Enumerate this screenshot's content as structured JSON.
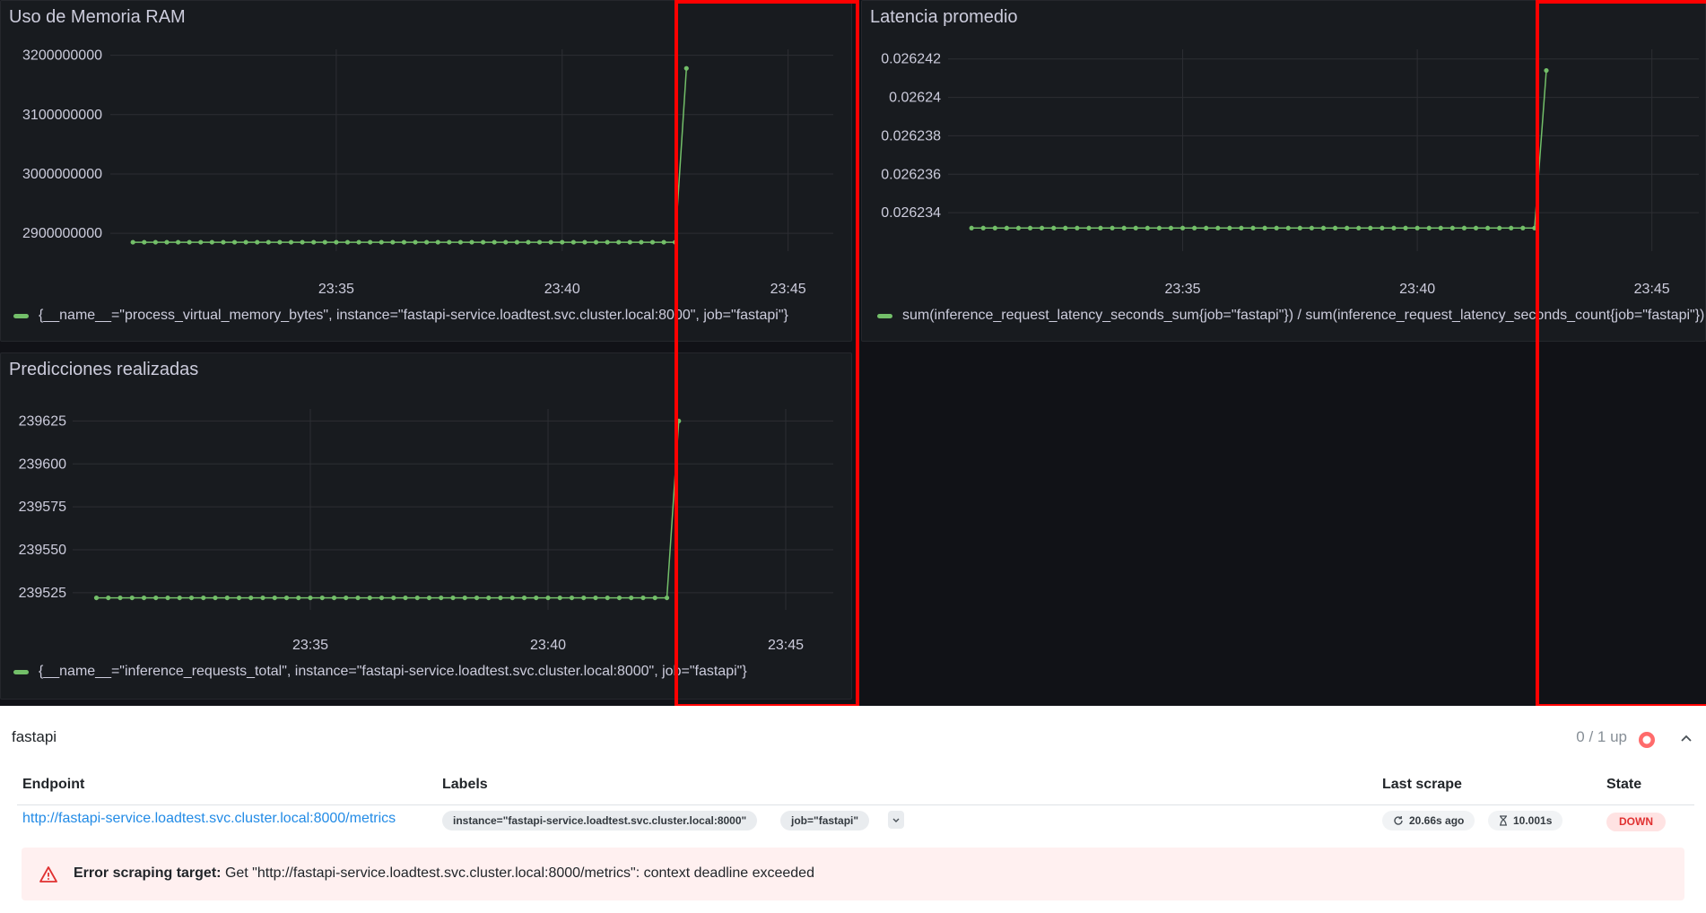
{
  "chart_data": [
    {
      "type": "line",
      "title": "Uso de Memoria RAM",
      "x": [
        "23:30:30",
        "23:30:45",
        "23:31:00",
        "23:31:15",
        "23:31:30",
        "23:31:45",
        "23:32:00",
        "23:32:15",
        "23:32:30",
        "23:32:45",
        "23:33:00",
        "23:33:15",
        "23:33:30",
        "23:33:45",
        "23:34:00",
        "23:34:15",
        "23:34:30",
        "23:34:45",
        "23:35:00",
        "23:35:15",
        "23:35:30",
        "23:35:45",
        "23:36:00",
        "23:36:15",
        "23:36:30",
        "23:36:45",
        "23:37:00",
        "23:37:15",
        "23:37:30",
        "23:37:45",
        "23:38:00",
        "23:38:15",
        "23:38:30",
        "23:38:45",
        "23:39:00",
        "23:39:15",
        "23:39:30",
        "23:39:45",
        "23:40:00",
        "23:40:15",
        "23:40:30",
        "23:40:45",
        "23:41:00",
        "23:41:15",
        "23:41:30",
        "23:41:45",
        "23:42:00",
        "23:42:15",
        "23:42:30",
        "23:42:45"
      ],
      "series": [
        {
          "name": "{__name__=\"process_virtual_memory_bytes\", instance=\"fastapi-service.loadtest.svc.cluster.local:8000\", job=\"fastapi\"}",
          "values": [
            2885000000,
            2885000000,
            2885000000,
            2885000000,
            2885000000,
            2885000000,
            2885000000,
            2885000000,
            2885000000,
            2885000000,
            2885000000,
            2885000000,
            2885000000,
            2885000000,
            2885000000,
            2885000000,
            2885000000,
            2885000000,
            2885000000,
            2885000000,
            2885000000,
            2885000000,
            2885000000,
            2885000000,
            2885000000,
            2885000000,
            2885000000,
            2885000000,
            2885000000,
            2885000000,
            2885000000,
            2885000000,
            2885000000,
            2885000000,
            2885000000,
            2885000000,
            2885000000,
            2885000000,
            2885000000,
            2885000000,
            2885000000,
            2885000000,
            2885000000,
            2885000000,
            2885000000,
            2885000000,
            2885000000,
            2885000000,
            2885000000,
            3178000000
          ],
          "color": "#73bf69"
        }
      ],
      "x_ticks": [
        {
          "t": "23:35:00",
          "label": "23:35"
        },
        {
          "t": "23:40:00",
          "label": "23:40"
        },
        {
          "t": "23:45:00",
          "label": "23:45"
        }
      ],
      "x_range": [
        "23:30:00",
        "23:46:00"
      ],
      "y_ticks": [
        {
          "v": 2900000000,
          "label": "2900000000"
        },
        {
          "v": 3000000000,
          "label": "3000000000"
        },
        {
          "v": 3100000000,
          "label": "3100000000"
        },
        {
          "v": 3200000000,
          "label": "3200000000"
        }
      ],
      "ylim": [
        2870000000,
        3210000000
      ],
      "grid": true,
      "legend": "bottom"
    },
    {
      "type": "line",
      "title": "Latencia promedio",
      "x": [
        "23:30:30",
        "23:30:45",
        "23:31:00",
        "23:31:15",
        "23:31:30",
        "23:31:45",
        "23:32:00",
        "23:32:15",
        "23:32:30",
        "23:32:45",
        "23:33:00",
        "23:33:15",
        "23:33:30",
        "23:33:45",
        "23:34:00",
        "23:34:15",
        "23:34:30",
        "23:34:45",
        "23:35:00",
        "23:35:15",
        "23:35:30",
        "23:35:45",
        "23:36:00",
        "23:36:15",
        "23:36:30",
        "23:36:45",
        "23:37:00",
        "23:37:15",
        "23:37:30",
        "23:37:45",
        "23:38:00",
        "23:38:15",
        "23:38:30",
        "23:38:45",
        "23:39:00",
        "23:39:15",
        "23:39:30",
        "23:39:45",
        "23:40:00",
        "23:40:15",
        "23:40:30",
        "23:40:45",
        "23:41:00",
        "23:41:15",
        "23:41:30",
        "23:41:45",
        "23:42:00",
        "23:42:15",
        "23:42:30",
        "23:42:45"
      ],
      "series": [
        {
          "name": "sum(inference_request_latency_seconds_sum{job=\"fastapi\"}) / sum(inference_request_latency_seconds_count{job=\"fastapi\"})",
          "values": [
            0.0262332,
            0.0262332,
            0.0262332,
            0.0262332,
            0.0262332,
            0.0262332,
            0.0262332,
            0.0262332,
            0.0262332,
            0.0262332,
            0.0262332,
            0.0262332,
            0.0262332,
            0.0262332,
            0.0262332,
            0.0262332,
            0.0262332,
            0.0262332,
            0.0262332,
            0.0262332,
            0.0262332,
            0.0262332,
            0.0262332,
            0.0262332,
            0.0262332,
            0.0262332,
            0.0262332,
            0.0262332,
            0.0262332,
            0.0262332,
            0.0262332,
            0.0262332,
            0.0262332,
            0.0262332,
            0.0262332,
            0.0262332,
            0.0262332,
            0.0262332,
            0.0262332,
            0.0262332,
            0.0262332,
            0.0262332,
            0.0262332,
            0.0262332,
            0.0262332,
            0.0262332,
            0.0262332,
            0.0262332,
            0.0262332,
            0.0262414
          ],
          "color": "#73bf69"
        }
      ],
      "x_ticks": [
        {
          "t": "23:35:00",
          "label": "23:35"
        },
        {
          "t": "23:40:00",
          "label": "23:40"
        },
        {
          "t": "23:45:00",
          "label": "23:45"
        }
      ],
      "x_range": [
        "23:30:00",
        "23:46:00"
      ],
      "y_ticks": [
        {
          "v": 0.026234,
          "label": "0.026234"
        },
        {
          "v": 0.026236,
          "label": "0.026236"
        },
        {
          "v": 0.026238,
          "label": "0.026238"
        },
        {
          "v": 0.02624,
          "label": "0.02624"
        },
        {
          "v": 0.026242,
          "label": "0.026242"
        }
      ],
      "ylim": [
        0.026232,
        0.0262425
      ],
      "grid": true,
      "legend": "bottom"
    },
    {
      "type": "line",
      "title": "Predicciones realizadas",
      "x": [
        "23:30:30",
        "23:30:45",
        "23:31:00",
        "23:31:15",
        "23:31:30",
        "23:31:45",
        "23:32:00",
        "23:32:15",
        "23:32:30",
        "23:32:45",
        "23:33:00",
        "23:33:15",
        "23:33:30",
        "23:33:45",
        "23:34:00",
        "23:34:15",
        "23:34:30",
        "23:34:45",
        "23:35:00",
        "23:35:15",
        "23:35:30",
        "23:35:45",
        "23:36:00",
        "23:36:15",
        "23:36:30",
        "23:36:45",
        "23:37:00",
        "23:37:15",
        "23:37:30",
        "23:37:45",
        "23:38:00",
        "23:38:15",
        "23:38:30",
        "23:38:45",
        "23:39:00",
        "23:39:15",
        "23:39:30",
        "23:39:45",
        "23:40:00",
        "23:40:15",
        "23:40:30",
        "23:40:45",
        "23:41:00",
        "23:41:15",
        "23:41:30",
        "23:41:45",
        "23:42:00",
        "23:42:15",
        "23:42:30",
        "23:42:45"
      ],
      "series": [
        {
          "name": "{__name__=\"inference_requests_total\", instance=\"fastapi-service.loadtest.svc.cluster.local:8000\", job=\"fastapi\"}",
          "values": [
            239522,
            239522,
            239522,
            239522,
            239522,
            239522,
            239522,
            239522,
            239522,
            239522,
            239522,
            239522,
            239522,
            239522,
            239522,
            239522,
            239522,
            239522,
            239522,
            239522,
            239522,
            239522,
            239522,
            239522,
            239522,
            239522,
            239522,
            239522,
            239522,
            239522,
            239522,
            239522,
            239522,
            239522,
            239522,
            239522,
            239522,
            239522,
            239522,
            239522,
            239522,
            239522,
            239522,
            239522,
            239522,
            239522,
            239522,
            239522,
            239522,
            239625
          ],
          "color": "#73bf69"
        }
      ],
      "x_ticks": [
        {
          "t": "23:35:00",
          "label": "23:35"
        },
        {
          "t": "23:40:00",
          "label": "23:40"
        },
        {
          "t": "23:45:00",
          "label": "23:45"
        }
      ],
      "x_range": [
        "23:30:00",
        "23:46:00"
      ],
      "y_ticks": [
        {
          "v": 239525,
          "label": "239525"
        },
        {
          "v": 239550,
          "label": "239550"
        },
        {
          "v": 239575,
          "label": "239575"
        },
        {
          "v": 239600,
          "label": "239600"
        },
        {
          "v": 239625,
          "label": "239625"
        }
      ],
      "ylim": [
        239515,
        239632
      ],
      "grid": true,
      "legend": "bottom"
    }
  ],
  "panels": [
    {
      "title": "Uso de Memoria RAM",
      "legend": "{__name__=\"process_virtual_memory_bytes\", instance=\"fastapi-service.loadtest.svc.cluster.local:8000\", job=\"fastapi\"}"
    },
    {
      "title": "Latencia promedio",
      "legend": "sum(inference_request_latency_seconds_sum{job=\"fastapi\"}) / sum(inference_request_latency_seconds_count{job=\"fastapi\"})"
    },
    {
      "title": "Predicciones realizadas",
      "legend": "{__name__=\"inference_requests_total\", instance=\"fastapi-service.loadtest.svc.cluster.local:8000\", job=\"fastapi\"}"
    }
  ],
  "targets": {
    "job_name": "fastapi",
    "up_status": "0 / 1 up",
    "headers": {
      "endpoint": "Endpoint",
      "labels": "Labels",
      "last_scrape": "Last scrape",
      "state": "State"
    },
    "row": {
      "endpoint": "http://fastapi-service.loadtest.svc.cluster.local:8000/metrics",
      "labels": [
        "instance=\"fastapi-service.loadtest.svc.cluster.local:8000\"",
        "job=\"fastapi\""
      ],
      "last_scrape": "20.66s ago",
      "scrape_duration": "10.001s",
      "state": "DOWN"
    },
    "error": {
      "label": "Error scraping target:",
      "message": "Get \"http://fastapi-service.loadtest.svc.cluster.local:8000/metrics\": context deadline exceeded"
    }
  },
  "icons": {
    "status_dot": "status-down-dot-icon",
    "collapse": "chevron-up-icon",
    "refresh": "refresh-icon",
    "duration": "hourglass-icon",
    "error": "warning-triangle-icon",
    "expand": "chevron-down-icon"
  },
  "colors": {
    "series": "#73bf69",
    "down": "#e03131",
    "down_bg": "#ffe3e3",
    "error_bg": "#fff0f0",
    "link": "#228be6",
    "highlight": "#ff0000"
  }
}
